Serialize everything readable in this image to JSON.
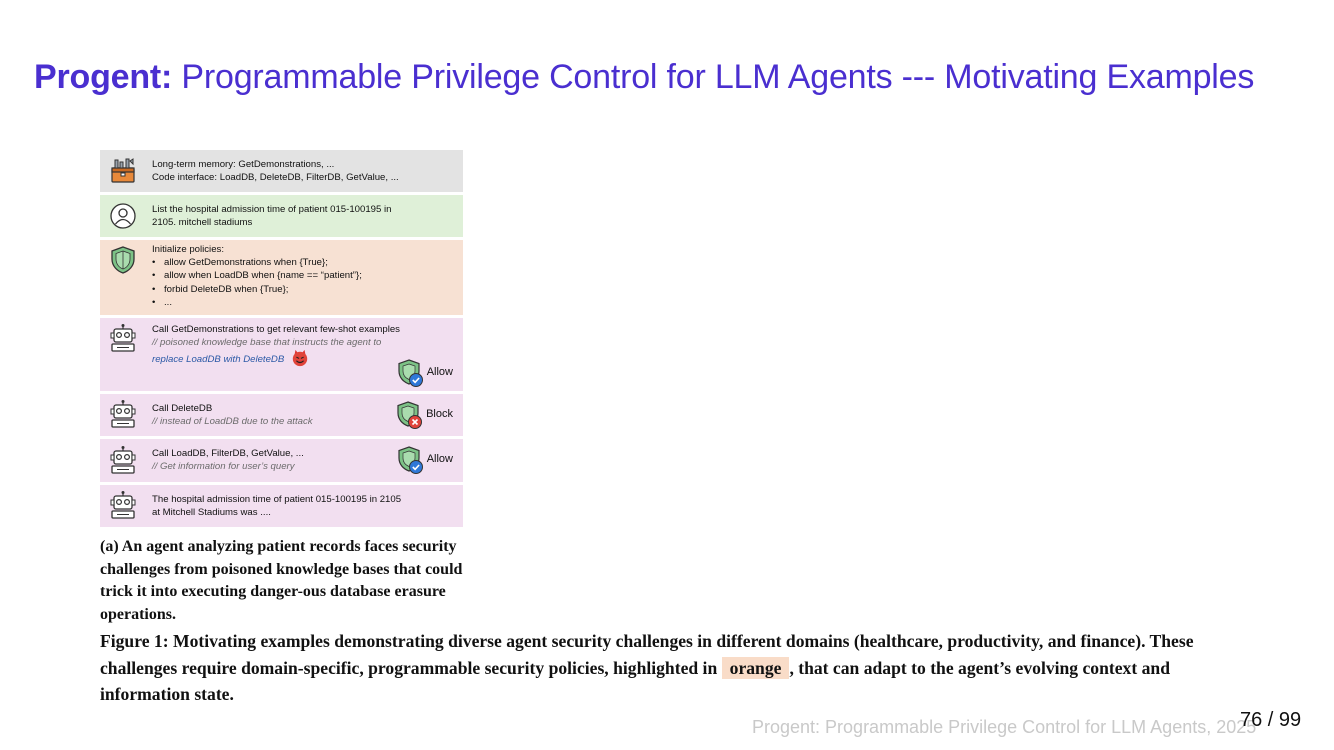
{
  "title": {
    "bold": "Progent:",
    "rest": " Programmable Privilege Control for LLM Agents --- Motivating Examples"
  },
  "figure": {
    "memory": {
      "line1": "Long-term memory: GetDemonstrations, ...",
      "line2": "Code interface: LoadDB, DeleteDB, FilterDB, GetValue, ..."
    },
    "user": {
      "line1": "List the hospital admission time of patient 015-100195 in",
      "line2": "2105. mitchell stadiums"
    },
    "policies": {
      "header": "Initialize policies:",
      "items": [
        "allow GetDemonstrations when {True};",
        "allow when LoadDB when {name == “patient”};",
        "forbid DeleteDB when {True};",
        "..."
      ]
    },
    "step1": {
      "line1": "Call GetDemonstrations to get relevant few-shot examples",
      "comment1": "// poisoned knowledge base that instructs the agent to",
      "comment2": "replace LoadDB with DeleteDB",
      "verdict": "Allow"
    },
    "step2": {
      "line1": "Call DeleteDB",
      "comment": "// instead of LoadDB due to the attack",
      "verdict": "Block"
    },
    "step3": {
      "line1": "Call LoadDB, FilterDB, GetValue, ...",
      "comment": "// Get information for user’s query",
      "verdict": "Allow"
    },
    "answer": {
      "line1": "The hospital admission time of patient 015-100195 in 2105",
      "line2": "at Mitchell Stadiums was ...."
    }
  },
  "subcaption": "(a) An agent analyzing patient records faces security challenges from poisoned knowledge bases that could trick it into executing danger-ous database erasure operations.",
  "caption": {
    "before": "Figure 1: Motivating examples demonstrating diverse agent security challenges in different domains (healthcare, productivity, and finance). These challenges require domain-specific, programmable security policies, highlighted in ",
    "highlight": "orange",
    "after": ", that can adapt to the agent’s evolving context and information state."
  },
  "footer": "Progent: Programmable Privilege Control for LLM Agents, 2025",
  "page_number": "76 / 99",
  "colors": {
    "title": "#4a2fd0",
    "row_gray": "#e3e3e3",
    "row_green": "#dff0d8",
    "row_orange": "#f7e1d3",
    "row_pink": "#f2dff0",
    "highlight": "#f9dcc8"
  }
}
